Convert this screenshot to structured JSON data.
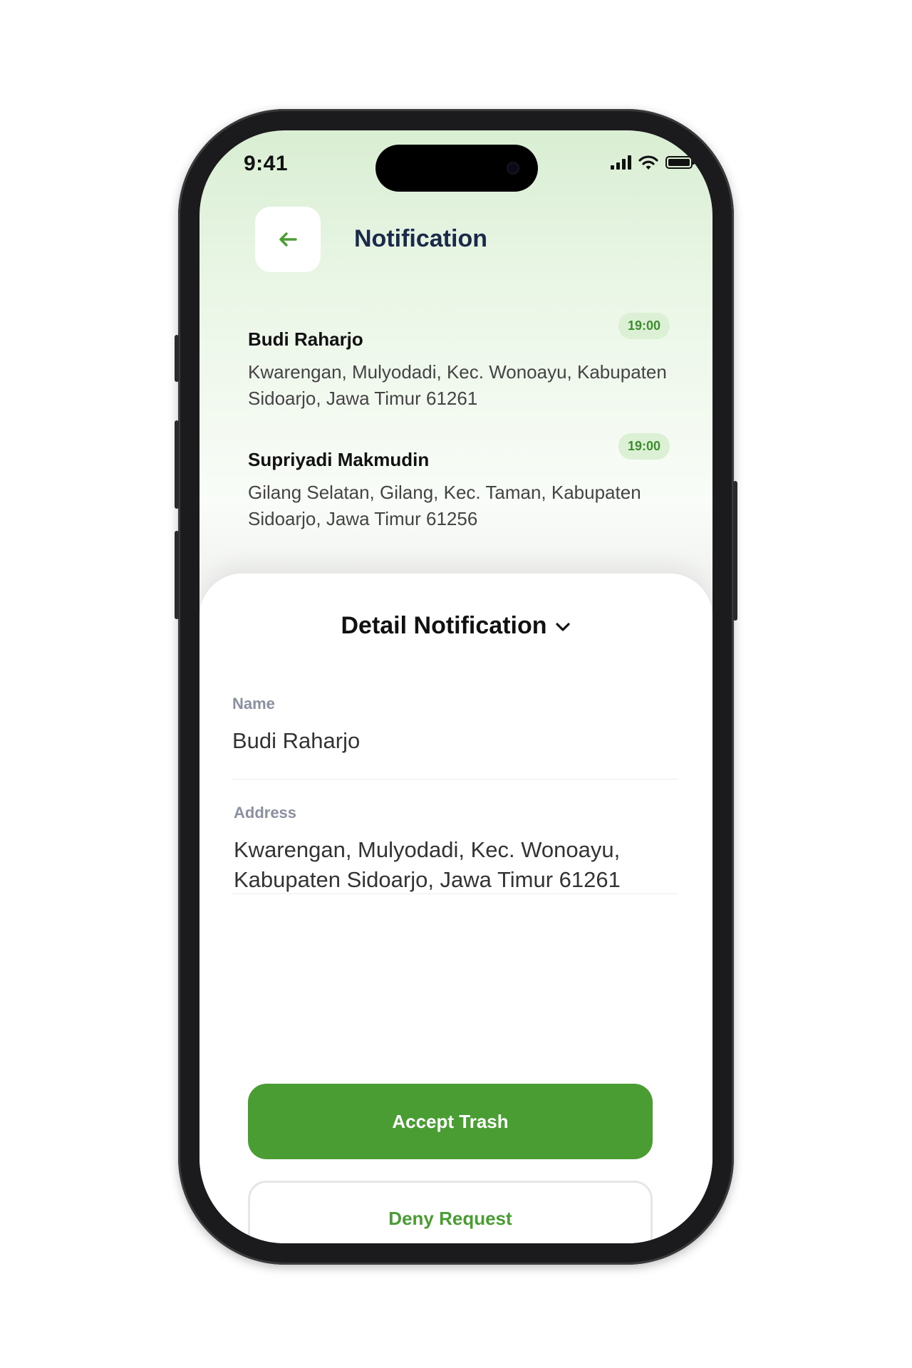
{
  "status_bar": {
    "time": "9:41"
  },
  "header": {
    "title": "Notification"
  },
  "notifications": [
    {
      "name": "Budi Raharjo",
      "address": "Kwarengan, Mulyodadi, Kec. Wonoayu, Kabupaten Sidoarjo, Jawa Timur 61261",
      "time": "19:00"
    },
    {
      "name": "Supriyadi Makmudin",
      "address": "Gilang Selatan, Gilang, Kec. Taman, Kabupaten Sidoarjo, Jawa Timur 61256",
      "time": "19:00"
    }
  ],
  "detail": {
    "title": "Detail Notification",
    "name_label": "Name",
    "name_value": "Budi Raharjo",
    "address_label": "Address",
    "address_value": "Kwarengan, Mulyodadi, Kec. Wonoayu, Kabupaten Sidoarjo, Jawa Timur 61261"
  },
  "actions": {
    "accept_label": "Accept Trash",
    "deny_label": "Deny Request"
  },
  "colors": {
    "accent": "#4a9d33",
    "title": "#1c2a4a",
    "badge_bg": "#dcf0d5"
  },
  "icons": {
    "back": "arrow-left-icon",
    "chevron": "chevron-down-icon"
  }
}
